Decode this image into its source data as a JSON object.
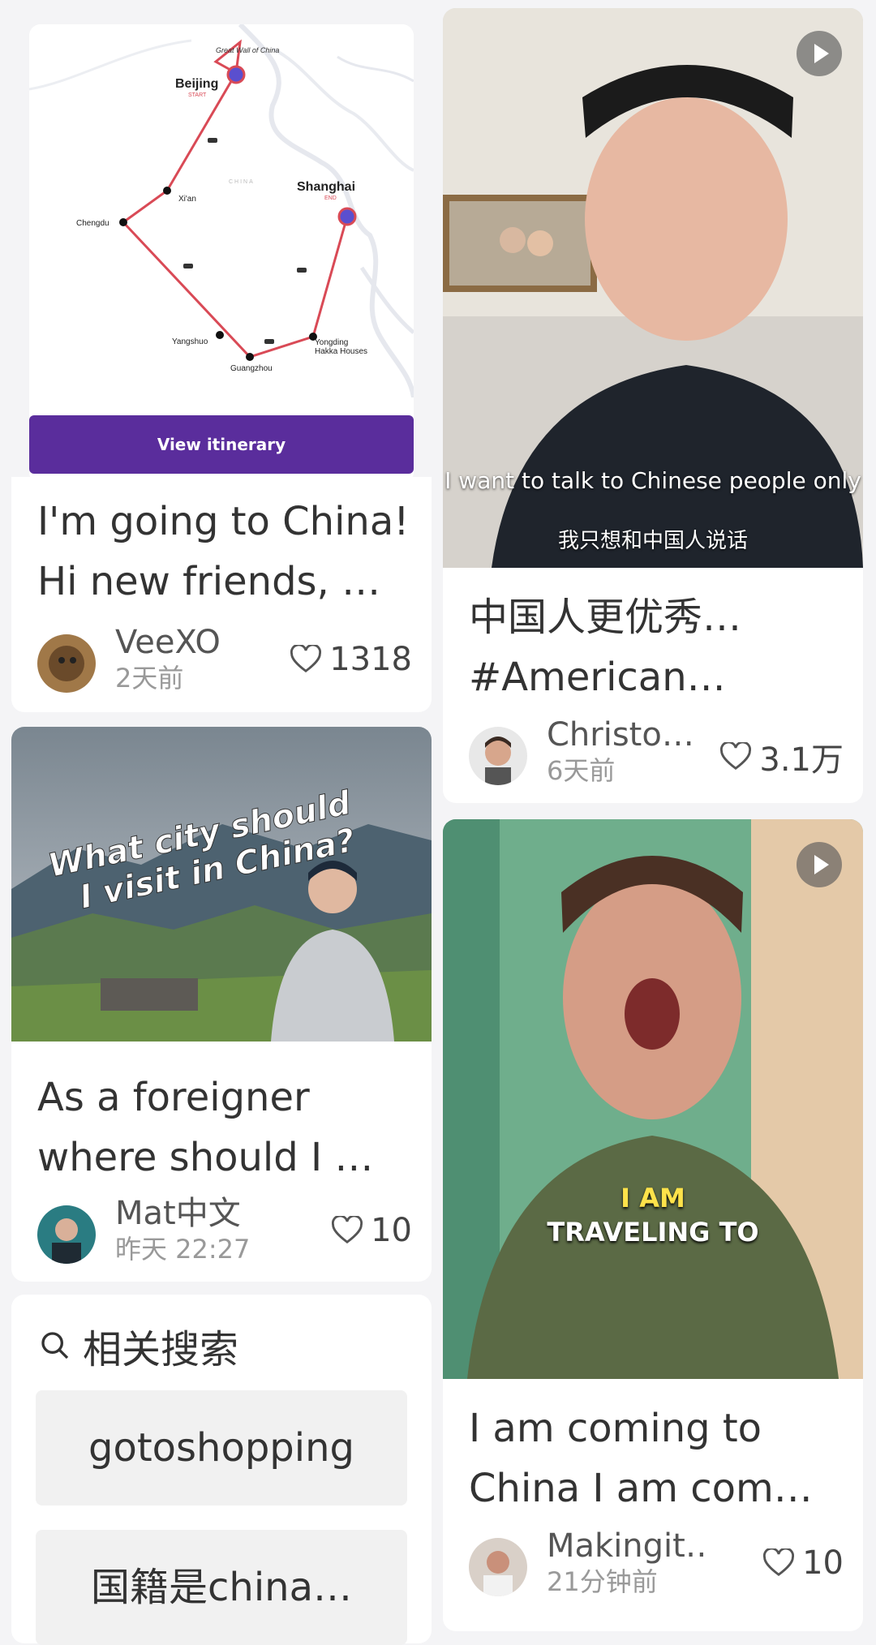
{
  "feed": {
    "left": [
      {
        "type": "map-card",
        "map": {
          "label_great_wall": "Great Wall of China",
          "label_beijing": "Beijing",
          "label_start": "START",
          "label_shanghai": "Shanghai",
          "label_end": "END",
          "label_xian": "Xi'an",
          "label_chengdu": "Chengdu",
          "label_china": "CHINA",
          "label_yangshuo": "Yangshuo",
          "label_guangzhou": "Guangzhou",
          "label_yongding": "Yongding",
          "label_hakka": "Hakka Houses",
          "button": "View itinerary"
        },
        "title": "I'm going to China! Hi new friends, …",
        "author": "VeeXO",
        "time": "2天前",
        "likes": "1318"
      },
      {
        "type": "photo-card",
        "overlay_line1": "What city should",
        "overlay_line2": "I visit in China?",
        "title": "As a foreigner where should I …",
        "author": "Mat中文",
        "time": "昨天 22:27",
        "likes": "10"
      }
    ],
    "right": [
      {
        "type": "video-card",
        "subtitle_en": "I want to talk to Chinese people only",
        "subtitle_zh": "我只想和中国人说话",
        "title": "中国人更优秀…#American…",
        "author": "Christo…",
        "time": "6天前",
        "likes": "3.1万"
      },
      {
        "type": "video-card",
        "caption_line1": "I AM",
        "caption_line2": "TRAVELING TO",
        "title": "I am coming to China I am com…",
        "author": "Makingit…",
        "time": "21分钟前",
        "likes": "10"
      }
    ]
  },
  "related_search": {
    "heading": "相关搜索",
    "items": [
      "gotoshopping",
      "国籍是china…"
    ]
  },
  "colors": {
    "accent_purple": "#5a2d9c",
    "route_red": "#d94a56",
    "background": "#f4f4f6"
  },
  "icons": [
    "heart-icon",
    "search-icon",
    "play-icon"
  ]
}
